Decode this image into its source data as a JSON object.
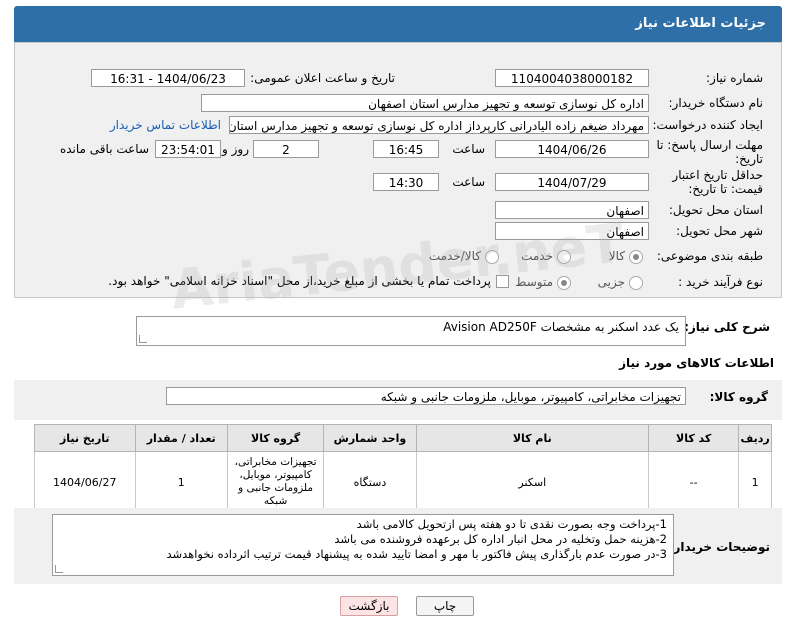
{
  "header": {
    "title": "جزئیات اطلاعات نیاز"
  },
  "need_number": {
    "label": "شماره نیاز:",
    "value": "1104004038000182"
  },
  "announce": {
    "label": "تاریخ و ساعت اعلان عمومی:",
    "value": "1404/06/23 - 16:31"
  },
  "buyer_org": {
    "label": "نام دستگاه خریدار:",
    "value": "اداره کل نوسازی  توسعه و تجهیز مدارس استان اصفهان"
  },
  "creator": {
    "label": "ایجاد کننده درخواست:",
    "value": "مهرداد ضیغم زاده الیادرانی کارپرداز اداره کل نوسازی  توسعه و تجهیز مدارس استان اصفهان",
    "contact_link": "اطلاعات تماس خریدار"
  },
  "deadline": {
    "label": "مهلت ارسال پاسخ: تا تاریخ:",
    "date": "1404/06/26",
    "time_label": "ساعت",
    "time": "16:45",
    "days": "2",
    "days_label": "روز و",
    "remaining": "23:54:01",
    "remaining_label": "ساعت باقی مانده"
  },
  "validity": {
    "label": "حداقل تاریخ اعتبار قیمت: تا تاریخ:",
    "date": "1404/07/29",
    "time_label": "ساعت",
    "time": "14:30"
  },
  "province": {
    "label": "استان محل تحویل:",
    "value": "اصفهان"
  },
  "city": {
    "label": "شهر محل تحویل:",
    "value": "اصفهان"
  },
  "category": {
    "label": "طبقه بندی موضوعی:",
    "options": [
      "کالا",
      "خدمت",
      "کالا/خدمت"
    ]
  },
  "process": {
    "label": "نوع فرآیند خرید :",
    "options": [
      "جزیی",
      "متوسط"
    ],
    "payment_note": "پرداخت تمام یا بخشی از مبلغ خرید،از محل \"اسناد خزانه اسلامی\" خواهد بود."
  },
  "summary": {
    "label": "شرح کلی نیاز:",
    "value": "یک عدد اسکنر به مشخصات Avision AD250F"
  },
  "goods_info": {
    "title": "اطلاعات کالاهای مورد نیاز"
  },
  "goods_group": {
    "label": "گروه کالا:",
    "value": "تجهیزات مخابراتی، کامپیوتر، موبایل، ملزومات جانبی و شبکه"
  },
  "table": {
    "headers": [
      "ردیف",
      "کد کالا",
      "نام کالا",
      "واحد شمارش",
      "گروه کالا",
      "تعداد / مقدار",
      "تاریخ نیاز"
    ],
    "rows": [
      [
        "1",
        "--",
        "اسکنر",
        "دستگاه",
        "تجهیزات مخابراتی، کامپیوتر، موبایل، ملزومات جانبی و شبکه",
        "1",
        "1404/06/27"
      ]
    ]
  },
  "buyer_notes": {
    "label": "توضیحات خریدار:",
    "lines": [
      "1-پرداخت وجه بصورت نقدی تا دو هفته پس ازتحویل کالامی باشد",
      "2-هزینه حمل وتخلیه در محل انبار اداره کل برعهده فروشنده می باشد",
      "3-در صورت عدم بارگذاری پیش فاکتور با مهر و امضا تایید شده به پیشنهاد قیمت ترتیب اثرداده نخواهدشد"
    ]
  },
  "buttons": {
    "print": "چاپ",
    "back": "بازگشت"
  },
  "watermark": "AriaTender.neT"
}
